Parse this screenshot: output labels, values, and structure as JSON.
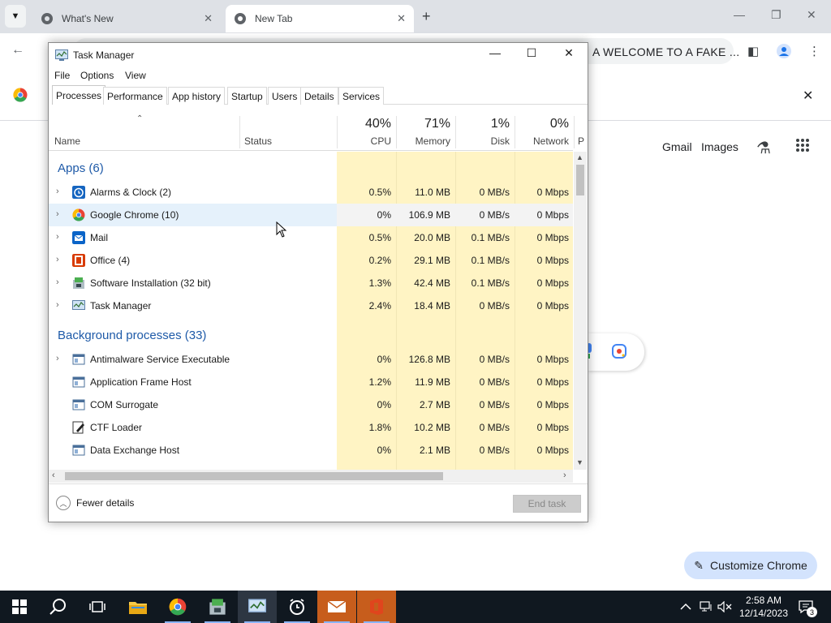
{
  "chrome": {
    "tabs": [
      {
        "title": "What's New",
        "active": false
      },
      {
        "title": "New Tab",
        "active": true
      }
    ],
    "omnibox_text": "A WELCOME TO A FAKE ...",
    "ntp": {
      "gmail_label": "Gmail",
      "images_label": "Images",
      "customize_label": "Customize Chrome"
    }
  },
  "task_manager": {
    "title": "Task Manager",
    "menus": [
      "File",
      "Options",
      "View"
    ],
    "tabs": [
      "Processes",
      "Performance",
      "App history",
      "Startup",
      "Users",
      "Details",
      "Services"
    ],
    "active_tab": "Processes",
    "columns": {
      "name": "Name",
      "status": "Status",
      "cpu": {
        "pct": "40%",
        "label": "CPU"
      },
      "memory": {
        "pct": "71%",
        "label": "Memory"
      },
      "disk": {
        "pct": "1%",
        "label": "Disk"
      },
      "network": {
        "pct": "0%",
        "label": "Network"
      },
      "power_partial": "P"
    },
    "apps_group": "Apps (6)",
    "apps": [
      {
        "name": "Alarms & Clock (2)",
        "cpu": "0.5%",
        "mem": "11.0 MB",
        "disk": "0 MB/s",
        "net": "0 Mbps",
        "icon": "alarms-clock-icon",
        "color": "#1565c0"
      },
      {
        "name": "Google Chrome (10)",
        "cpu": "0%",
        "mem": "106.9 MB",
        "disk": "0 MB/s",
        "net": "0 Mbps",
        "icon": "chrome-icon",
        "color": "#ea4335"
      },
      {
        "name": "Mail",
        "cpu": "0.5%",
        "mem": "20.0 MB",
        "disk": "0.1 MB/s",
        "net": "0 Mbps",
        "icon": "mail-icon",
        "color": "#0a64c8"
      },
      {
        "name": "Office (4)",
        "cpu": "0.2%",
        "mem": "29.1 MB",
        "disk": "0.1 MB/s",
        "net": "0 Mbps",
        "icon": "office-icon",
        "color": "#d83b01"
      },
      {
        "name": "Software Installation (32 bit)",
        "cpu": "1.3%",
        "mem": "42.4 MB",
        "disk": "0.1 MB/s",
        "net": "0 Mbps",
        "icon": "installer-icon",
        "color": "#4caf50"
      },
      {
        "name": "Task Manager",
        "cpu": "2.4%",
        "mem": "18.4 MB",
        "disk": "0 MB/s",
        "net": "0 Mbps",
        "icon": "task-manager-icon",
        "color": "#5b8fc7"
      }
    ],
    "bg_group": "Background processes (33)",
    "bg": [
      {
        "name": "Antimalware Service Executable",
        "cpu": "0%",
        "mem": "126.8 MB",
        "disk": "0 MB/s",
        "net": "0 Mbps",
        "expand": true
      },
      {
        "name": "Application Frame Host",
        "cpu": "1.2%",
        "mem": "11.9 MB",
        "disk": "0 MB/s",
        "net": "0 Mbps",
        "expand": false
      },
      {
        "name": "COM Surrogate",
        "cpu": "0%",
        "mem": "2.7 MB",
        "disk": "0 MB/s",
        "net": "0 Mbps",
        "expand": false
      },
      {
        "name": "CTF Loader",
        "cpu": "1.8%",
        "mem": "10.2 MB",
        "disk": "0 MB/s",
        "net": "0 Mbps",
        "expand": false
      },
      {
        "name": "Data Exchange Host",
        "cpu": "0%",
        "mem": "2.1 MB",
        "disk": "0 MB/s",
        "net": "0 Mbps",
        "expand": false
      }
    ],
    "footer": {
      "fewer_details": "Fewer details",
      "end_task": "End task"
    }
  },
  "taskbar": {
    "time": "2:58 AM",
    "date": "12/14/2023",
    "notifications": "3"
  },
  "colors": {
    "heat_light": "#fff4c4",
    "heat_medium": "#ffeaa5",
    "link_blue": "#1e5aa8",
    "taskbar_bg": "#101820"
  }
}
